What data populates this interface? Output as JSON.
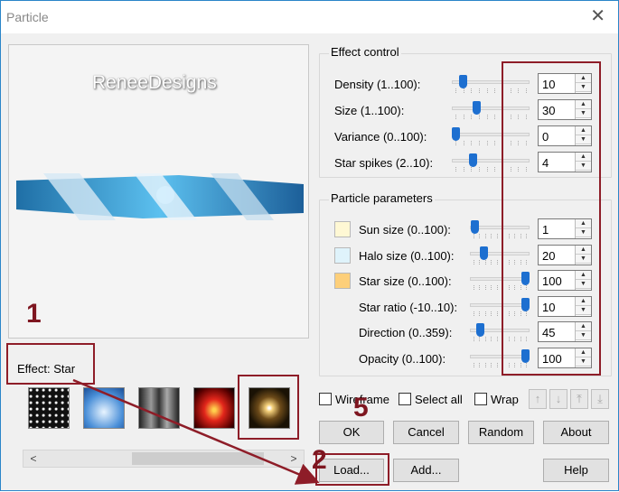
{
  "window": {
    "title": "Particle",
    "close_icon": "close-icon"
  },
  "preview": {
    "brand": "ReneeDesigns"
  },
  "effect_label": "Effect: Star",
  "thumbnails": [
    {
      "name": "noise-thumb"
    },
    {
      "name": "blue-glow-thumb"
    },
    {
      "name": "smoke-thumb"
    },
    {
      "name": "fire-thumb"
    },
    {
      "name": "star-thumb",
      "selected": true
    }
  ],
  "effect_control": {
    "title": "Effect control",
    "rows": [
      {
        "label": "Density (1..100):",
        "value": "10",
        "slider_fraction": 0.1
      },
      {
        "label": "Size (1..100):",
        "value": "30",
        "slider_fraction": 0.3
      },
      {
        "label": "Variance (0..100):",
        "value": "0",
        "slider_fraction": 0.0
      },
      {
        "label": "Star spikes (2..10):",
        "value": "4",
        "slider_fraction": 0.25
      }
    ]
  },
  "particle_parameters": {
    "title": "Particle parameters",
    "rows": [
      {
        "label": "Sun size (0..100):",
        "value": "1",
        "slider_fraction": 0.01,
        "swatch": "#fff8d4"
      },
      {
        "label": "Halo size (0..100):",
        "value": "20",
        "slider_fraction": 0.2,
        "swatch": "#dff3fb"
      },
      {
        "label": "Star size (0..100):",
        "value": "100",
        "slider_fraction": 1.0,
        "swatch": "#fdcf7a"
      },
      {
        "label": "Star ratio (-10..10):",
        "value": "10",
        "slider_fraction": 1.0
      },
      {
        "label": "Direction (0..359):",
        "value": "45",
        "slider_fraction": 0.13
      },
      {
        "label": "Opacity (0..100):",
        "value": "100",
        "slider_fraction": 1.0
      }
    ]
  },
  "checks": {
    "wireframe": "Wireframe",
    "select_all": "Select all",
    "wrap": "Wrap"
  },
  "buttons": {
    "ok": "OK",
    "cancel": "Cancel",
    "random": "Random",
    "about": "About",
    "load": "Load...",
    "add": "Add...",
    "help": "Help"
  },
  "annotations": {
    "n1": "1",
    "n2": "2",
    "n5": "5"
  },
  "colors": {
    "annotation": "#8e1d28",
    "slider_knob": "#1d6fd0"
  }
}
